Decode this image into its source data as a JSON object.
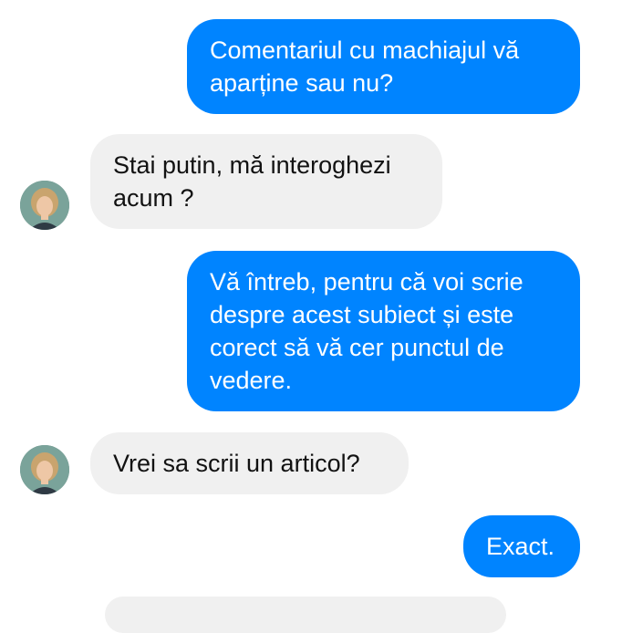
{
  "conversation": {
    "messages": [
      {
        "sender": "me",
        "text": "Comentariul cu machiajul vă\naparține sau nu?"
      },
      {
        "sender": "contact",
        "text": "Stai putin, mă interoghezi\nacum ?"
      },
      {
        "sender": "me",
        "text": "Vă întreb, pentru că voi scrie\ndespre acest subiect și este\ncorect să vă cer punctul de\nvedere."
      },
      {
        "sender": "contact",
        "text": "Vrei sa scrii un articol?"
      },
      {
        "sender": "me",
        "text": "Exact."
      }
    ]
  },
  "colors": {
    "outgoing_bubble": "#0084ff",
    "incoming_bubble": "#f0f0f0",
    "outgoing_text": "#ffffff",
    "incoming_text": "#121212"
  },
  "icons": {
    "contact_avatar": "avatar-portrait-icon"
  }
}
